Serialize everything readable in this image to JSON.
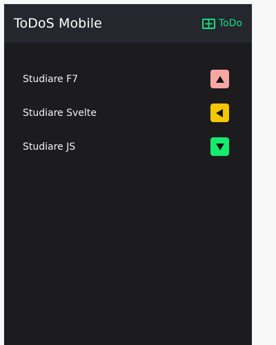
{
  "app": {
    "title": "ToDoS Mobile",
    "add_label": "ToDo"
  },
  "todos": [
    {
      "text": "Studiare F7",
      "priority_icon": "arrow-up-icon",
      "button_color": "#f8a7a0"
    },
    {
      "text": "Studiare Svelte",
      "priority_icon": "arrow-left-icon",
      "button_color": "#f3c803"
    },
    {
      "text": "Studiare JS",
      "priority_icon": "arrow-down-icon",
      "button_color": "#16ea6f"
    }
  ],
  "colors": {
    "background": "#1c1c1f",
    "navbar": "#25262e",
    "accent": "#12e37d"
  }
}
